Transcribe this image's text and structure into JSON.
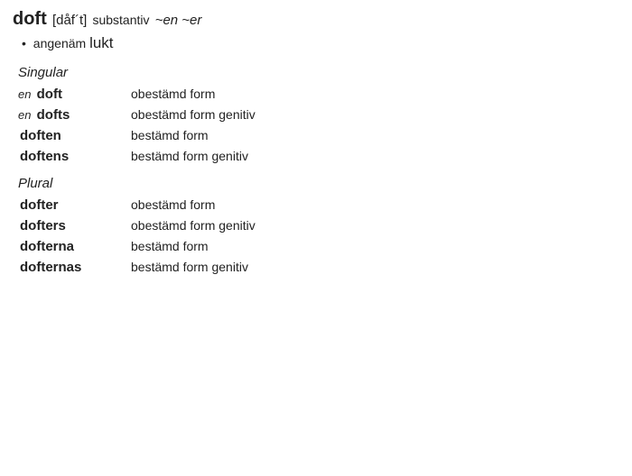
{
  "headline": {
    "word": "doft",
    "pronunciation": "[dåf´t]",
    "pos": "substantiv",
    "inflection": "~en ~er"
  },
  "definition": {
    "bullet": "•",
    "pre": "angenäm",
    "high": "lukt"
  },
  "sections": [
    {
      "title": "Singular",
      "rows": [
        {
          "article": "en",
          "form": "doft",
          "desc": "obestämd form"
        },
        {
          "article": "en",
          "form": "dofts",
          "desc": "obestämd form genitiv"
        },
        {
          "article": "",
          "form": "doften",
          "desc": "bestämd form"
        },
        {
          "article": "",
          "form": "doftens",
          "desc": "bestämd form genitiv"
        }
      ]
    },
    {
      "title": "Plural",
      "rows": [
        {
          "article": "",
          "form": "dofter",
          "desc": "obestämd form"
        },
        {
          "article": "",
          "form": "dofters",
          "desc": "obestämd form genitiv"
        },
        {
          "article": "",
          "form": "dofterna",
          "desc": "bestämd form"
        },
        {
          "article": "",
          "form": "dofternas",
          "desc": "bestämd form genitiv"
        }
      ]
    }
  ]
}
